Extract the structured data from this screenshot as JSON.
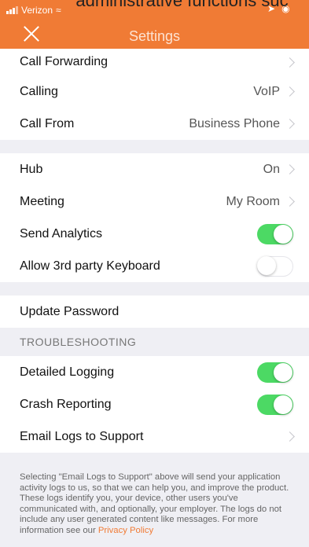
{
  "overlay_caption": "administrative functions suc",
  "status_bar": {
    "carrier": "Verizon",
    "icons": [
      "signal-icon",
      "wifi-icon",
      "location-icon",
      "alarm-icon"
    ]
  },
  "header": {
    "title": "Settings",
    "close_icon": "close-icon"
  },
  "rows_group1": [
    {
      "label": "Call Forwarding",
      "value": "",
      "chevron": true
    },
    {
      "label": "Calling",
      "value": "VoIP",
      "chevron": true
    },
    {
      "label": "Call From",
      "value": "Business Phone",
      "chevron": true
    }
  ],
  "rows_group2": [
    {
      "label": "Hub",
      "value": "On",
      "chevron": true
    },
    {
      "label": "Meeting",
      "value": "My Room",
      "chevron": true
    },
    {
      "label": "Send Analytics",
      "toggle": true
    },
    {
      "label": "Allow 3rd party Keyboard",
      "toggle": false
    }
  ],
  "rows_group3": [
    {
      "label": "Update Password"
    }
  ],
  "troubleshooting": {
    "header": "TROUBLESHOOTING",
    "rows": [
      {
        "label": "Detailed Logging",
        "toggle": true
      },
      {
        "label": "Crash Reporting",
        "toggle": true
      },
      {
        "label": "Email Logs to Support",
        "chevron": true
      }
    ]
  },
  "footer": {
    "text": "Selecting \"Email Logs to Support\" above will send your application activity logs to us, so that we can help you, and improve the product. These logs identify you, your device, other users you've communicated with, and optionally, your employer. The logs do not include any user generated content like messages. For more information see our ",
    "link": "Privacy Policy"
  },
  "colors": {
    "accent": "#f07b35",
    "toggle_on": "#4cd964"
  }
}
